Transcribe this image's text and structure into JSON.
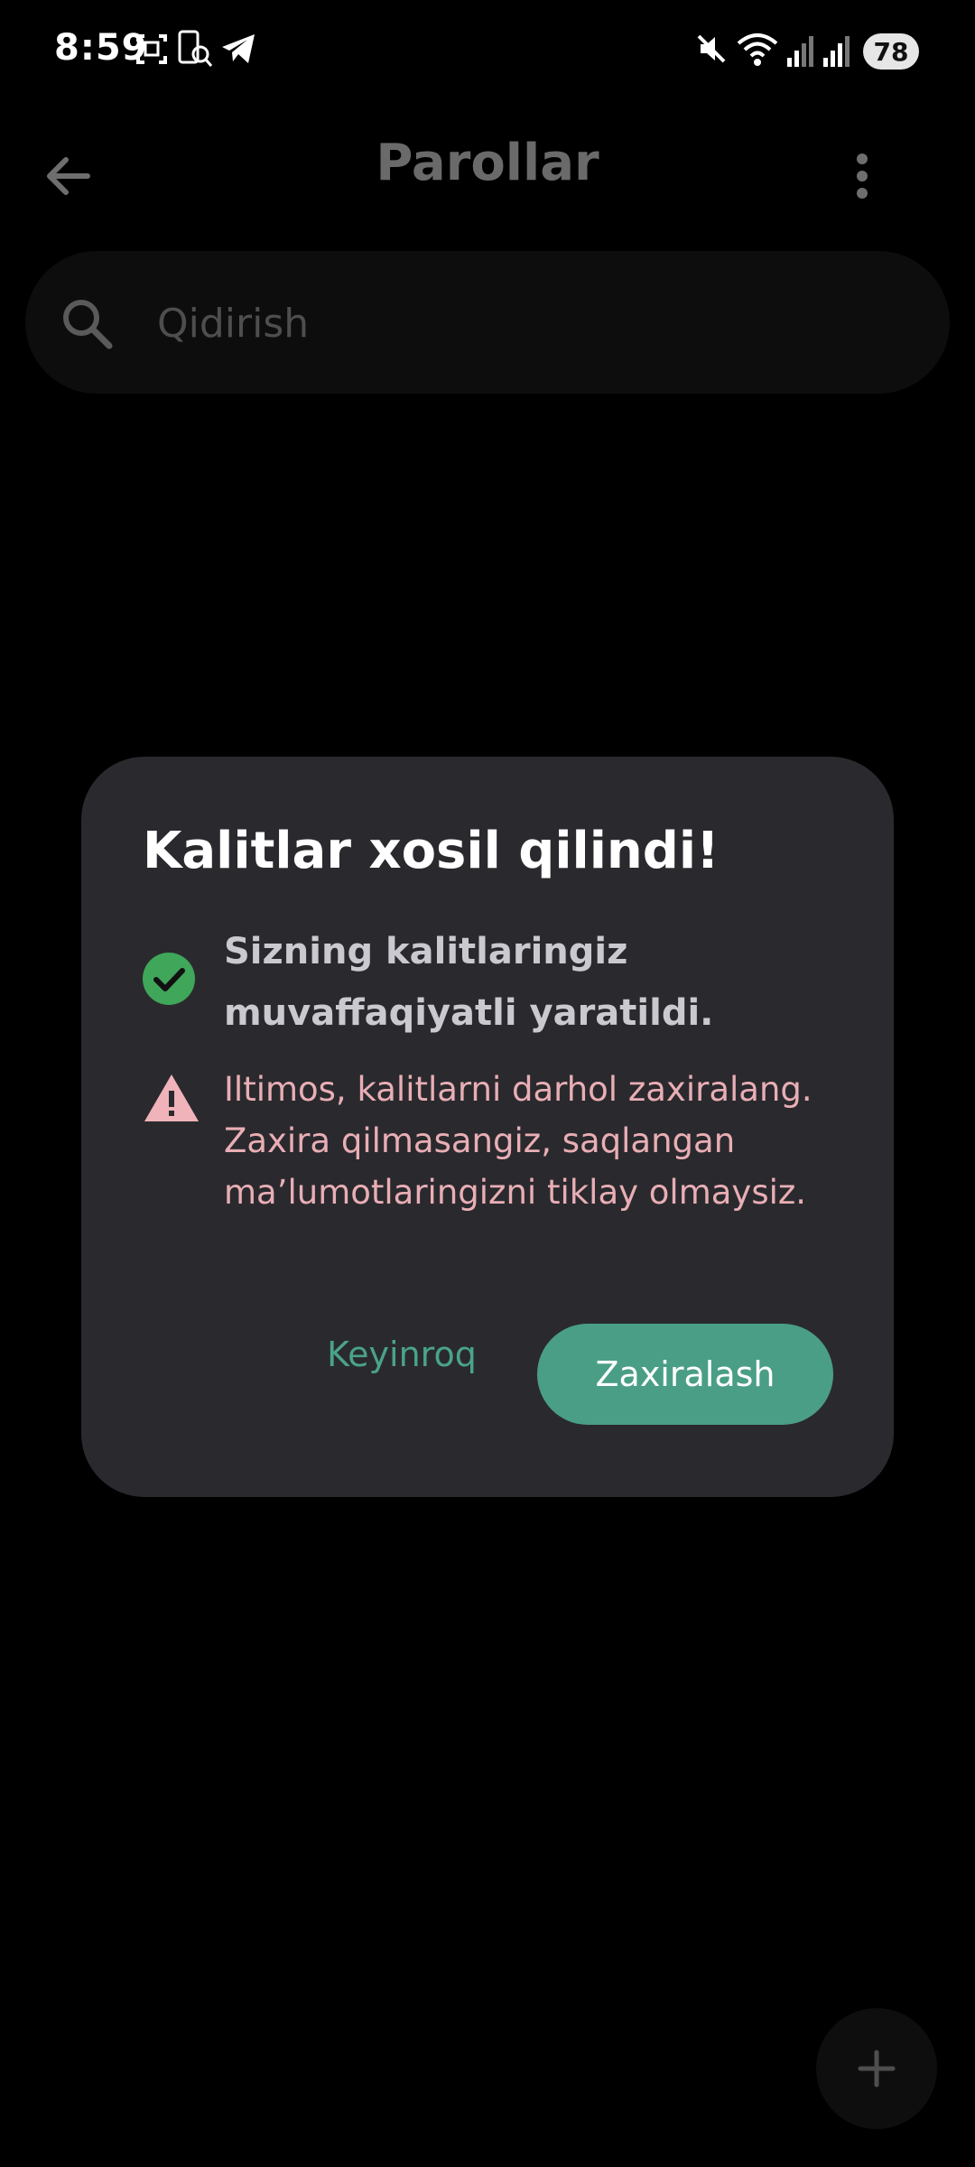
{
  "status_bar": {
    "time": "8:59",
    "battery": "78",
    "icons": [
      "screenshot-icon",
      "app-scan-icon",
      "telegram-icon",
      "mute-icon",
      "wifi-icon",
      "signal-icon",
      "signal-icon"
    ]
  },
  "app_bar": {
    "title": "Parollar",
    "back_icon": "arrow-left-icon",
    "more_icon": "more-vert-icon"
  },
  "search": {
    "placeholder": "Qidirish",
    "icon": "search-icon"
  },
  "dialog": {
    "title": "Kalitlar xosil qilindi!",
    "success_text": "Sizning kalitlaringiz muvaffaqiyatli yaratildi.",
    "warning_text": "Iltimos, kalitlarni darhol zaxiralang. Zaxira qilmasangiz, saqlangan ma’lumotlaringizni tiklay olmaysiz.",
    "later_label": "Keyinroq",
    "backup_label": "Zaxiralash"
  },
  "fab": {
    "icon": "plus-icon"
  },
  "colors": {
    "background": "#000000",
    "dialog_bg": "#2a2a2e",
    "accent": "#4a9e86",
    "success": "#3fa65a",
    "warning": "#f0b3b9"
  }
}
